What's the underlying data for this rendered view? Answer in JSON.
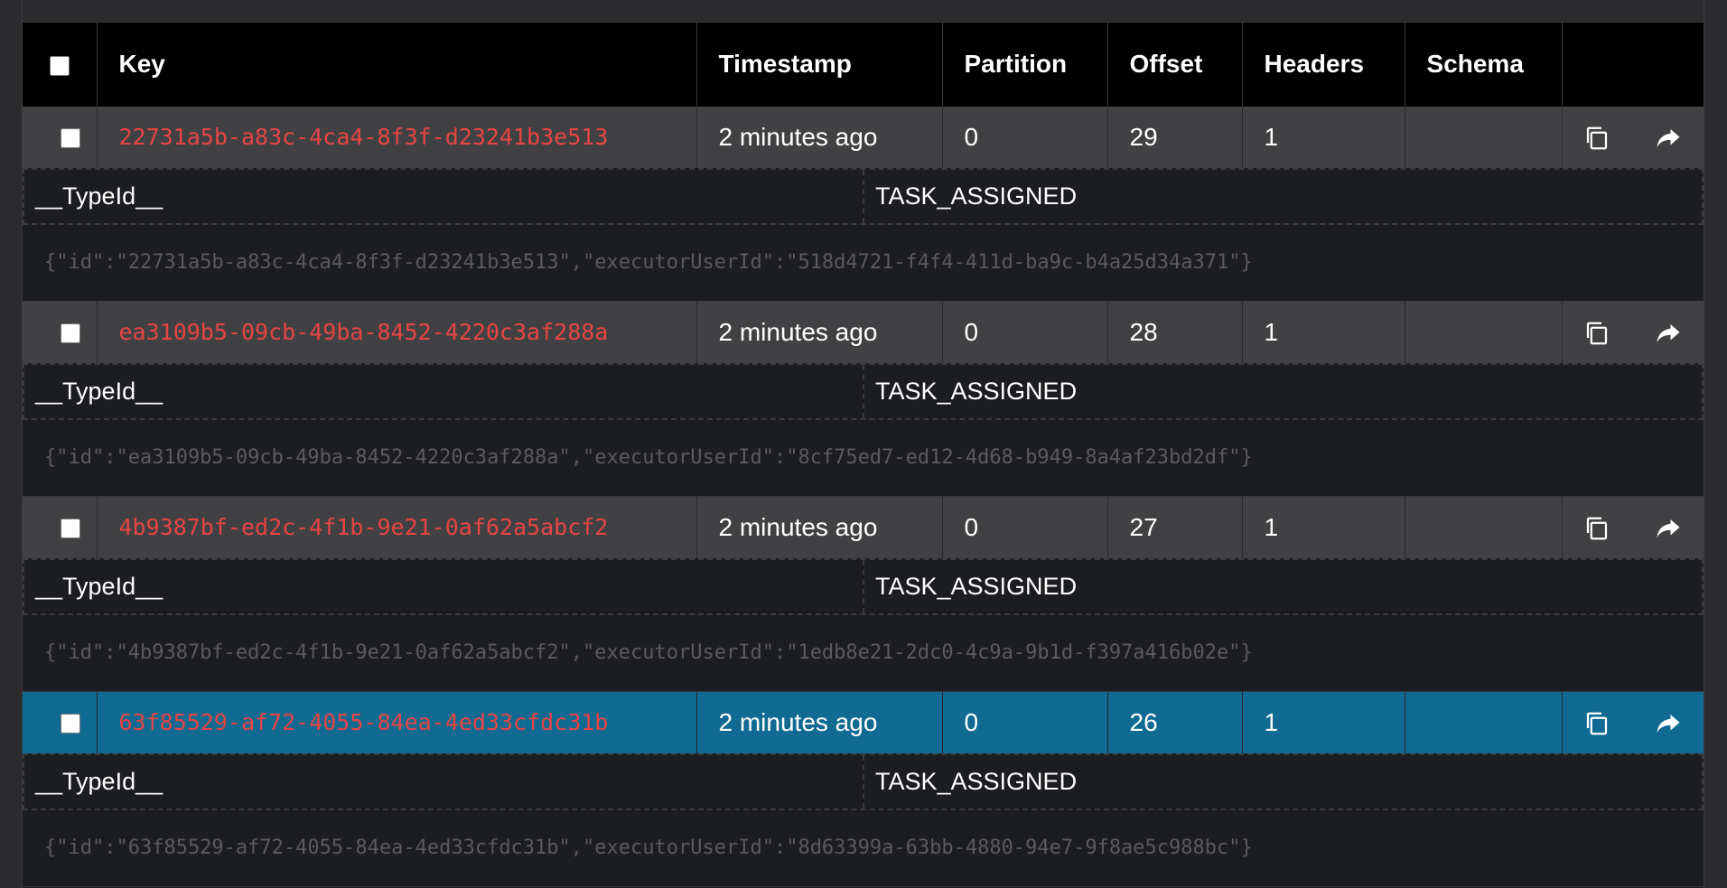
{
  "columns": {
    "key": "Key",
    "timestamp": "Timestamp",
    "partition": "Partition",
    "offset": "Offset",
    "headers": "Headers",
    "schema": "Schema"
  },
  "messages": [
    {
      "key": "22731a5b-a83c-4ca4-8f3f-d23241b3e513",
      "timestamp": "2 minutes ago",
      "partition": "0",
      "offset": "29",
      "headers": "1",
      "schema": "",
      "header_key": "__TypeId__",
      "header_value": "TASK_ASSIGNED",
      "value": "{\"id\":\"22731a5b-a83c-4ca4-8f3f-d23241b3e513\",\"executorUserId\":\"518d4721-f4f4-411d-ba9c-b4a25d34a371\"}",
      "selected": false
    },
    {
      "key": "ea3109b5-09cb-49ba-8452-4220c3af288a",
      "timestamp": "2 minutes ago",
      "partition": "0",
      "offset": "28",
      "headers": "1",
      "schema": "",
      "header_key": "__TypeId__",
      "header_value": "TASK_ASSIGNED",
      "value": "{\"id\":\"ea3109b5-09cb-49ba-8452-4220c3af288a\",\"executorUserId\":\"8cf75ed7-ed12-4d68-b949-8a4af23bd2df\"}",
      "selected": false
    },
    {
      "key": "4b9387bf-ed2c-4f1b-9e21-0af62a5abcf2",
      "timestamp": "2 minutes ago",
      "partition": "0",
      "offset": "27",
      "headers": "1",
      "schema": "",
      "header_key": "__TypeId__",
      "header_value": "TASK_ASSIGNED",
      "value": "{\"id\":\"4b9387bf-ed2c-4f1b-9e21-0af62a5abcf2\",\"executorUserId\":\"1edb8e21-2dc0-4c9a-9b1d-f397a416b02e\"}",
      "selected": false
    },
    {
      "key": "63f85529-af72-4055-84ea-4ed33cfdc31b",
      "timestamp": "2 minutes ago",
      "partition": "0",
      "offset": "26",
      "headers": "1",
      "schema": "",
      "header_key": "__TypeId__",
      "header_value": "TASK_ASSIGNED",
      "value": "{\"id\":\"63f85529-af72-4055-84ea-4ed33cfdc31b\",\"executorUserId\":\"8d63399a-63bb-4880-94e7-9f8ae5c988bc\"}",
      "selected": true
    }
  ],
  "icons": {
    "copy": "copy-icon",
    "share": "share-icon"
  },
  "colors": {
    "key_text": "#e64545",
    "selected_row": "#106a91",
    "row_bg": "#414143",
    "header_bg": "#000000"
  }
}
